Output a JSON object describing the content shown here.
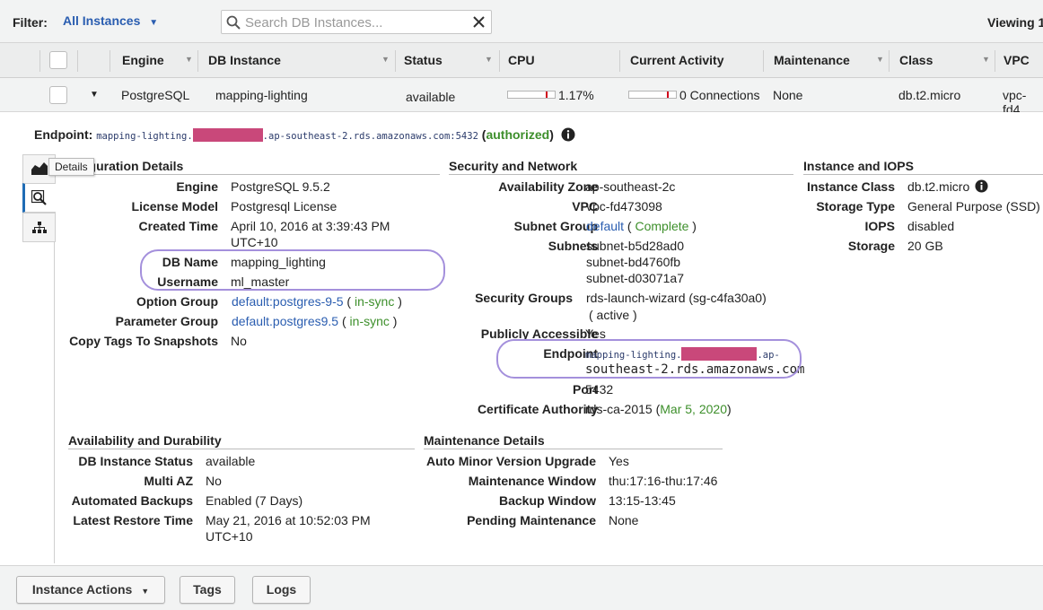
{
  "filterbar": {
    "filter_label": "Filter:",
    "filter_value": "All Instances",
    "search_placeholder": "Search DB Instances...",
    "viewing_label": "Viewing 1"
  },
  "table": {
    "columns": [
      "Engine",
      "DB Instance",
      "Status",
      "CPU",
      "Current Activity",
      "Maintenance",
      "Class",
      "VPC"
    ],
    "row": {
      "engine": "PostgreSQL",
      "db_instance": "mapping-lighting",
      "status": "available",
      "cpu": "1.17%",
      "current_activity": "0 Connections",
      "maintenance": "None",
      "class": "db.t2.micro",
      "vpc": "vpc-fd4"
    }
  },
  "endpoint_line": {
    "label": "Endpoint:",
    "host_prefix": "mapping-lighting.",
    "host_suffix": ".ap-southeast-2.rds.amazonaws.com:5432",
    "open_paren": "(",
    "state": "authorized",
    "close_paren": ")"
  },
  "tooltip": "Details",
  "configuration": {
    "title": "Configuration Details",
    "title_visible": "figuration Details",
    "engine_label": "Engine",
    "engine": "PostgreSQL 9.5.2",
    "license_label": "License Model",
    "license": "Postgresql License",
    "created_label": "Created Time",
    "created_1": "April 10, 2016 at 3:39:43 PM",
    "created_2": "UTC+10",
    "dbname_label": "DB Name",
    "dbname": "mapping_lighting",
    "username_label": "Username",
    "username": "ml_master",
    "option_label": "Option Group",
    "option": "default:postgres-9-5",
    "option_status": "in-sync",
    "param_label": "Parameter Group",
    "param": "default.postgres9.5",
    "param_status": "in-sync",
    "copytags_label": "Copy Tags To Snapshots",
    "copytags": "No"
  },
  "security": {
    "title": "Security and Network",
    "az_label": "Availability Zone",
    "az": "ap-southeast-2c",
    "vpc_label": "VPC",
    "vpc": "vpc-fd473098",
    "subnetgroup_label": "Subnet Group",
    "subnetgroup": "default",
    "subnetgroup_status": "Complete",
    "subnets_label": "Subnets",
    "subnet_1": "subnet-b5d28ad0",
    "subnet_2": "subnet-bd4760fb",
    "subnet_3": "subnet-d03071a7",
    "sg_label": "Security Groups",
    "sg": "rds-launch-wizard (sg-c4fa30a0)",
    "sg_status": "( active )",
    "public_label": "Publicly Accessible",
    "public": "Yes",
    "endpoint_label": "Endpoint",
    "endpoint_1": "mapping-lighting.",
    "endpoint_1b": ".ap-",
    "endpoint_2": "southeast-2.rds.amazonaws.com",
    "port_label": "Port",
    "port": "5432",
    "ca_label": "Certificate Authority",
    "ca": "rds-ca-2015",
    "ca_date": "Mar 5, 2020"
  },
  "iops": {
    "title": "Instance and IOPS",
    "class_label": "Instance Class",
    "class": "db.t2.micro",
    "storage_type_label": "Storage Type",
    "storage_type": "General Purpose (SSD)",
    "iops_label": "IOPS",
    "iops": "disabled",
    "storage_label": "Storage",
    "storage": "20 GB"
  },
  "availability": {
    "title": "Availability and Durability",
    "status_label": "DB Instance Status",
    "status": "available",
    "multiaz_label": "Multi AZ",
    "multiaz": "No",
    "backups_label": "Automated Backups",
    "backups": "Enabled (7 Days)",
    "restore_label": "Latest Restore Time",
    "restore_1": "May 21, 2016 at 10:52:03 PM",
    "restore_2": "UTC+10"
  },
  "maintenance": {
    "title": "Maintenance Details",
    "auto_label": "Auto Minor Version Upgrade",
    "auto": "Yes",
    "window_label": "Maintenance Window",
    "window": "thu:17:16-thu:17:46",
    "backup_label": "Backup Window",
    "backup": "13:15-13:45",
    "pending_label": "Pending Maintenance",
    "pending": "None"
  },
  "footer": {
    "instance_actions": "Instance Actions",
    "tags": "Tags",
    "logs": "Logs"
  },
  "colors": {
    "link": "#2a5db0",
    "green": "#3d8f2b",
    "red": "#d0021b",
    "highlight_ring": "#a490dc",
    "redaction": "#c9487a"
  }
}
